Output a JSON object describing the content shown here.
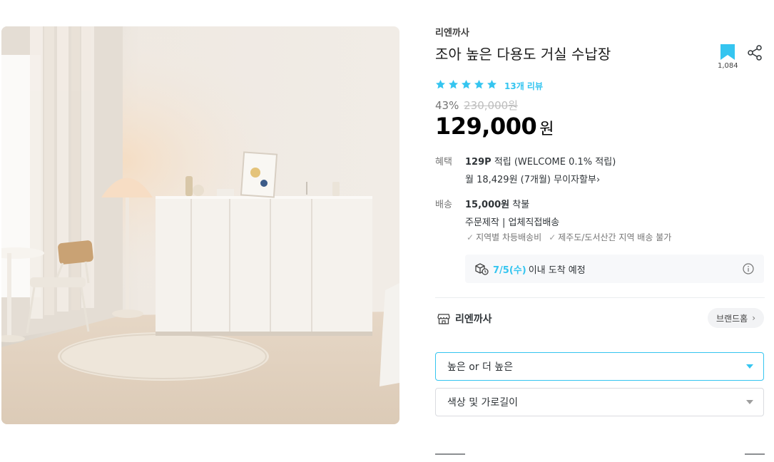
{
  "product": {
    "brand": "리엔까사",
    "title": "조아 높은 다용도 거실 수납장",
    "bookmark_count": "1,084",
    "rating": {
      "stars": 5,
      "review_label": "13개 리뷰"
    },
    "discount_rate": "43%",
    "original_price": "230,000원",
    "price": "129,000",
    "currency": "원"
  },
  "benefit": {
    "label": "혜택",
    "points": "129P",
    "points_text": "적립 (WELCOME 0.1% 적립)",
    "installment": "월 18,429원 (7개월) 무이자할부"
  },
  "shipping": {
    "label": "배송",
    "fee": "15,000원",
    "fee_type": "착불",
    "method": "주문제작 | 업체직접배송",
    "notes": [
      "지역별 차등배송비",
      "제주도/도서산간 지역 배송 불가"
    ],
    "arrival_date": "7/5(수)",
    "arrival_text": "이내 도착 예정"
  },
  "store": {
    "name": "리엔까사",
    "brand_home_label": "브랜드홈"
  },
  "options": {
    "option1": "높은 or 더 높은",
    "option2": "색상 및 가로길이"
  },
  "colors": {
    "accent": "#35c5f0",
    "text": "#2f3438",
    "muted": "#757575"
  }
}
